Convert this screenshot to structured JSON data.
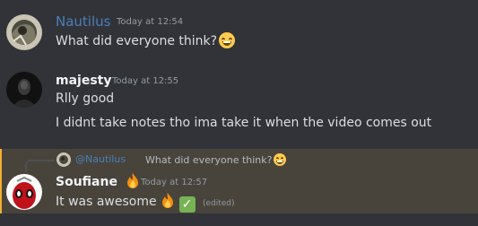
{
  "messages": [
    {
      "author": "Nautilus",
      "author_color": "#4a7fb8",
      "timestamp": "Today at 12:54",
      "lines": [
        "What did everyone think?"
      ],
      "avatar_icon": "grunge-art-avatar"
    },
    {
      "author": "majesty",
      "author_color": "#f2f3f5",
      "timestamp": "Today at 12:55",
      "lines": [
        "Rlly good",
        "I didnt take notes tho ima take it when the video comes out"
      ],
      "avatar_icon": "dark-portrait-avatar"
    },
    {
      "author": "Soufiane",
      "author_color": "#f2f3f5",
      "timestamp": "Today at 12:57",
      "lines": [
        "It was awesome"
      ],
      "edited_label": "(edited)",
      "avatar_icon": "red-hero-avatar",
      "reply": {
        "author": "@Nautilus",
        "text": "What did everyone think?"
      }
    }
  ],
  "colors": {
    "background": "#313338",
    "mention_highlight": "#48443c",
    "mention_border": "#f0b232"
  }
}
